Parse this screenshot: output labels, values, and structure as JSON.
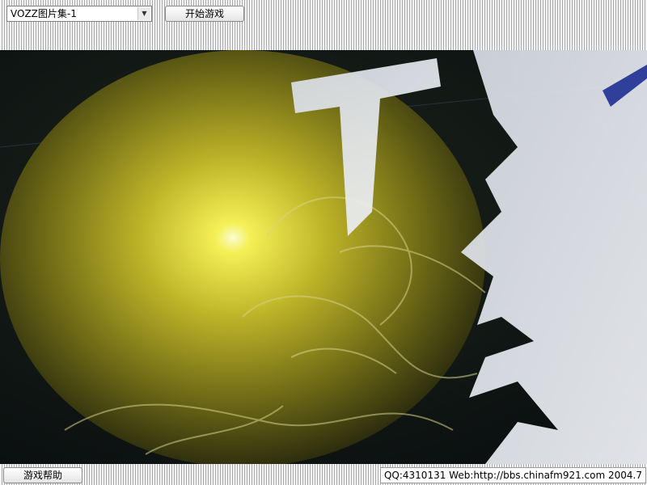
{
  "toolbar": {
    "album_select": {
      "selected": "VOZZ图片集-1"
    },
    "start_button": "开始游戏"
  },
  "footer": {
    "help_button": "游戏帮助",
    "info_text": "QQ:4310131 Web:http://bbs.chinafm921.com 2004.7"
  },
  "image": {
    "icon": "game-picture"
  },
  "colors": {
    "stripe_light": "#f4f4f4",
    "stripe_dark": "#a9a9a9",
    "image_glow": "#f4f055"
  }
}
